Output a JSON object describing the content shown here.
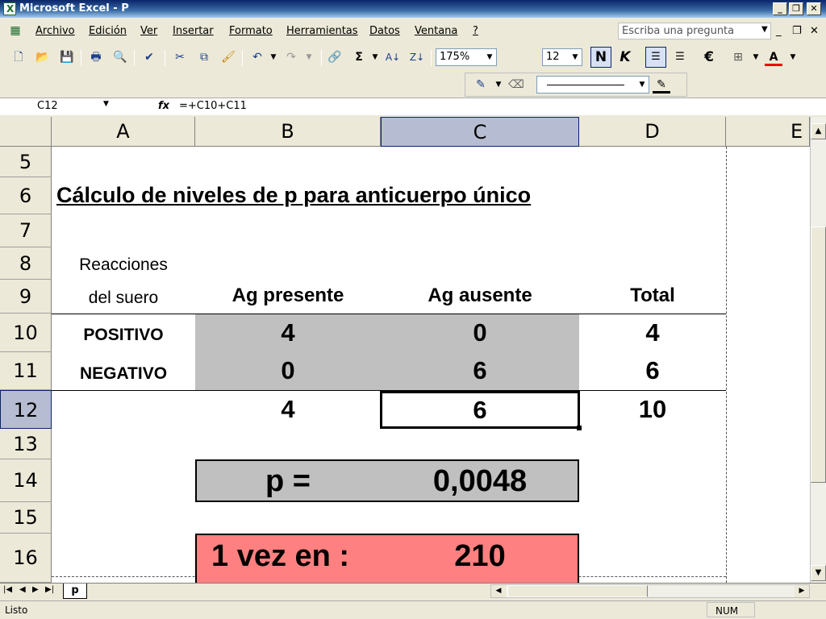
{
  "window": {
    "title": "Microsoft Excel - P"
  },
  "menu": {
    "items": [
      "Archivo",
      "Edición",
      "Ver",
      "Insertar",
      "Formato",
      "Herramientas",
      "Datos",
      "Ventana",
      "?"
    ],
    "ask_placeholder": "Escriba una pregunta"
  },
  "toolbar": {
    "zoom": "175%",
    "font_size": "12",
    "bold_label": "N",
    "italic_label": "K",
    "currency_label": "€",
    "font_color_label": "A"
  },
  "formula_bar": {
    "name_box": "C12",
    "fx_label": "fx",
    "formula": "=+C10+C11"
  },
  "columns": [
    "A",
    "B",
    "C",
    "D",
    "E"
  ],
  "rows": [
    "5",
    "6",
    "7",
    "8",
    "9",
    "10",
    "11",
    "12",
    "13",
    "14",
    "15",
    "16"
  ],
  "sheet": {
    "title": "Cálculo de niveles de p para anticuerpo único",
    "reacciones_line1": "Reacciones",
    "reacciones_line2": "del suero",
    "header_b": "Ag presente",
    "header_c": "Ag ausente",
    "header_d": "Total",
    "row10": {
      "label": "POSITIVO",
      "b": "4",
      "c": "0",
      "d": "4"
    },
    "row11": {
      "label": "NEGATIVO",
      "b": "0",
      "c": "6",
      "d": "6"
    },
    "row12": {
      "b": "4",
      "c": "6",
      "d": "10"
    },
    "p_label": "p =",
    "p_value": "0,0048",
    "vez_label": "1 vez en :",
    "vez_value": "210"
  },
  "tabs": {
    "active": "p"
  },
  "status": {
    "left": "Listo",
    "right": "NUM"
  },
  "colors": {
    "gray_fill": "#c0c0c0",
    "red_fill": "#ff8080",
    "selected_header": "#b6bdd2"
  }
}
